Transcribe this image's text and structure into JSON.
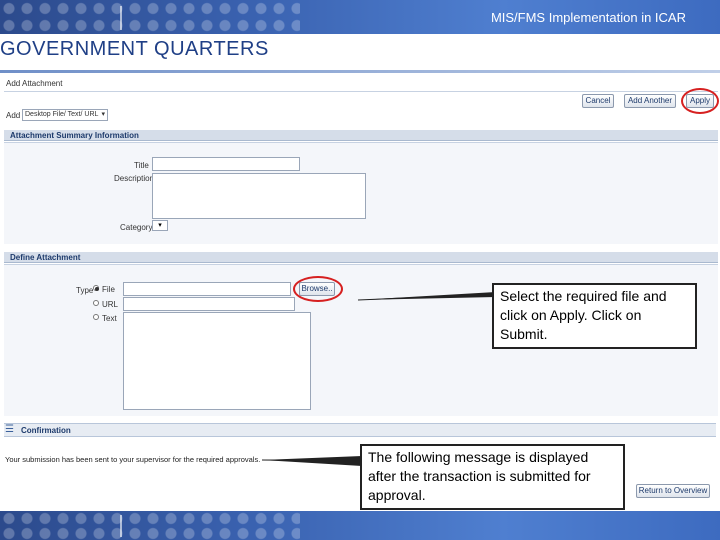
{
  "header": {
    "banner_title": "MIS/FMS Implementation in ICAR"
  },
  "page_title": "GOVERNMENT QUARTERS",
  "form": {
    "add_attachment_label": "Add Attachment",
    "add_label": "Add",
    "add_select_value": "Desktop File/ Text/ URL",
    "buttons": {
      "cancel": "Cancel",
      "add_another": "Add Another",
      "apply": "Apply"
    },
    "summary_section": "Attachment Summary Information",
    "title_label": "Title",
    "description_label": "Description",
    "category_label": "Category",
    "define_section": "Define Attachment",
    "type_label": "Type",
    "type_options": {
      "file": "File",
      "url": "URL",
      "text": "Text"
    },
    "browse_button": "Browse..",
    "confirmation_title": "Confirmation",
    "confirmation_message": "Your submission has been sent to your supervisor for the required approvals.",
    "return_button": "Return to Overview"
  },
  "callouts": {
    "select_file": "Select the required file and click on Apply. Click on Submit.",
    "message_note": "The following message is displayed after the transaction is submitted for approval."
  },
  "colors": {
    "oval": "#d62020",
    "banner": "#3a62b0"
  }
}
